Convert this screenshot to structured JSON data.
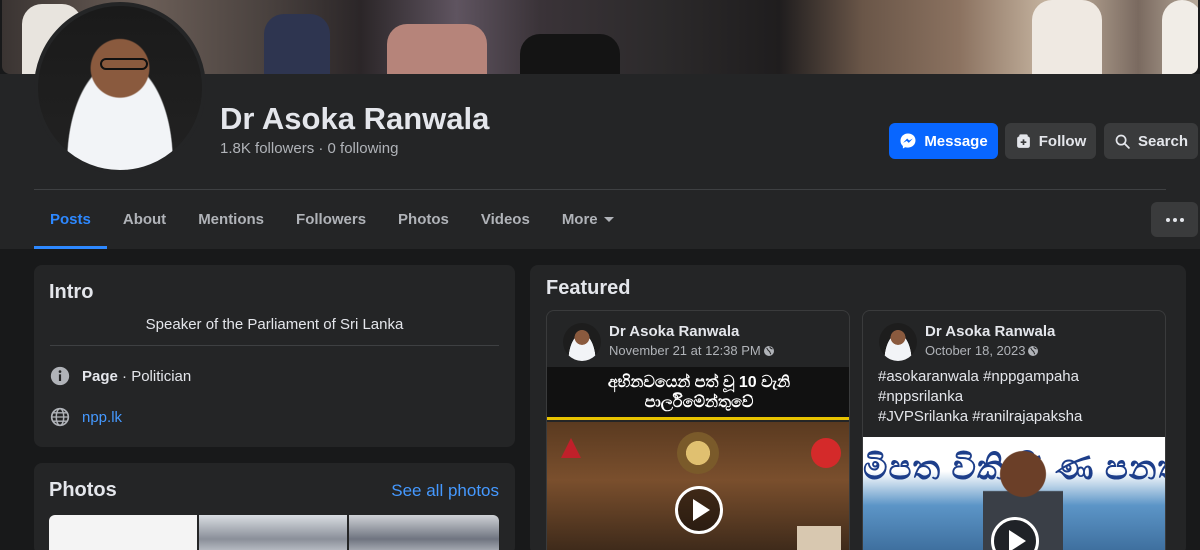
{
  "profile": {
    "name": "Dr Asoka Ranwala",
    "meta": "1.8K followers · 0 following"
  },
  "actions": {
    "message_label": "Message",
    "follow_label": "Follow",
    "search_label": "Search"
  },
  "tabs": [
    "Posts",
    "About",
    "Mentions",
    "Followers",
    "Photos",
    "Videos",
    "More"
  ],
  "intro": {
    "title": "Intro",
    "bio": "Speaker of the Parliament of Sri Lanka",
    "page_label": "Page",
    "category": " · Politician",
    "website": "npp.lk"
  },
  "photos": {
    "title": "Photos",
    "see_all": "See all photos"
  },
  "featured": {
    "title": "Featured",
    "posts": [
      {
        "author": "Dr Asoka Ranwala",
        "time": "November 21 at 12:38 PM",
        "banner": "අභිනවයෙන් පත් වූ 10 වැනි\nපාර්ලිමේන්තුවේ"
      },
      {
        "author": "Dr Asoka Ranwala",
        "time": "October 18, 2023",
        "text_lines": [
          "#asokaranwala #nppgampaha",
          "#nppsrilanka",
          "#JVPSrilanka #ranilrajapaksha"
        ],
        "banner": "මිපත විකිණි ණ පනත"
      }
    ]
  },
  "colors": {
    "accent": "#2d88ff",
    "message_button": "#0866ff",
    "background": "#18191a",
    "card": "#242526"
  }
}
